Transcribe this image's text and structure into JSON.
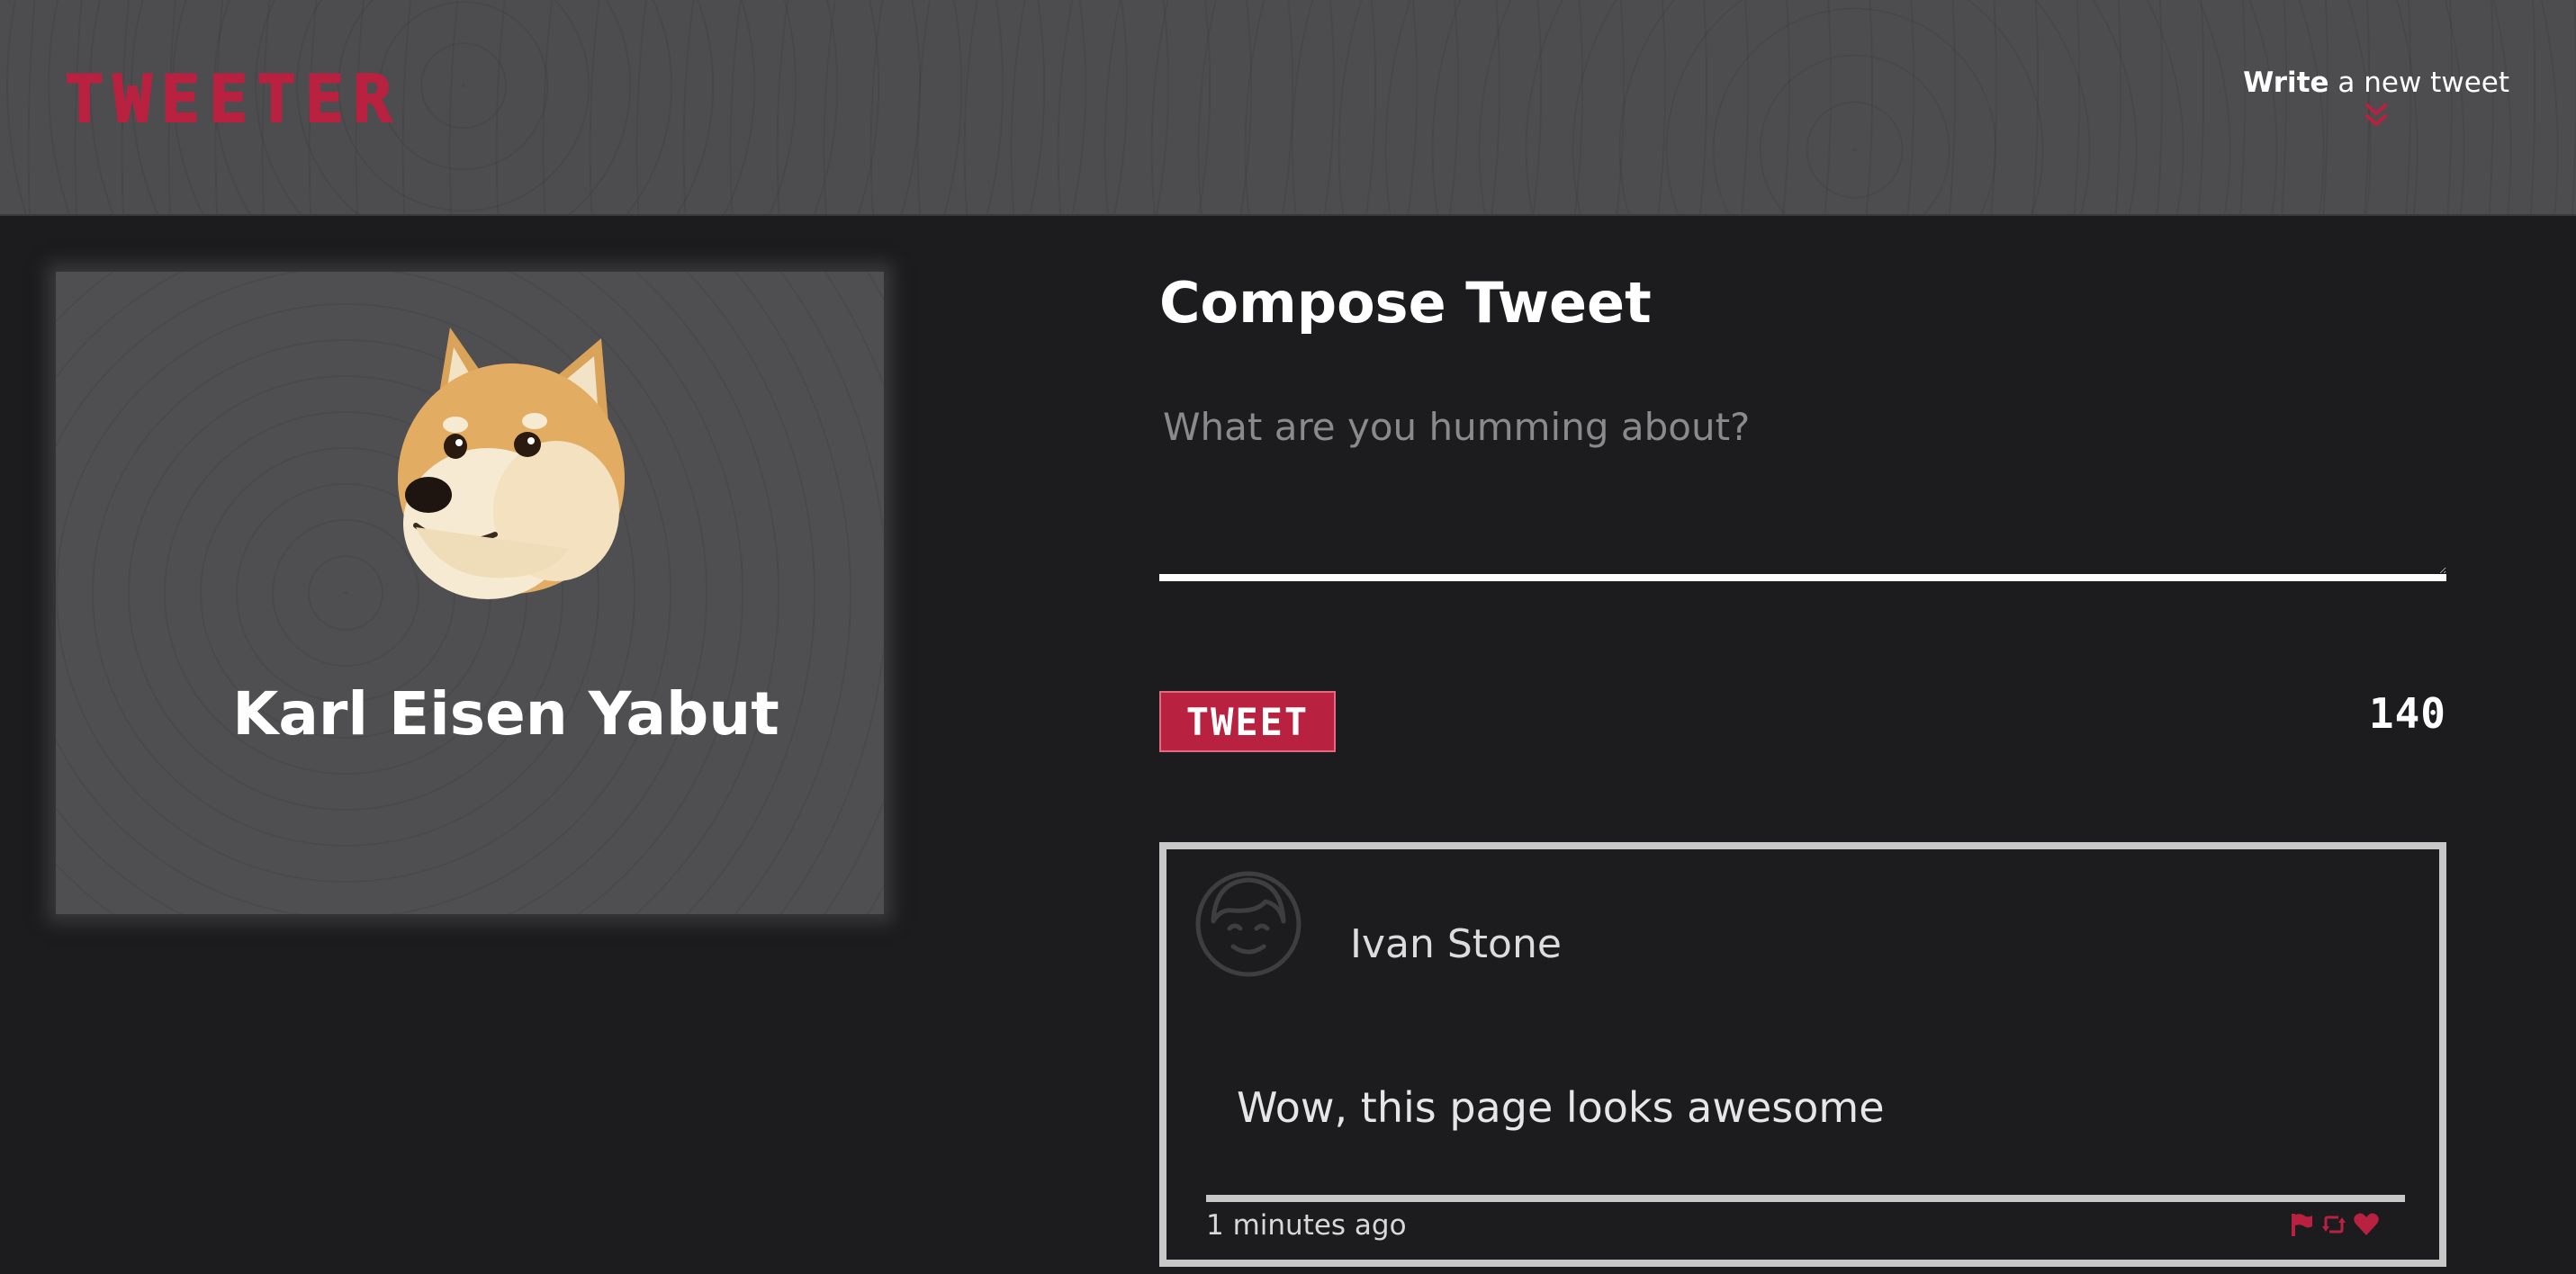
{
  "header": {
    "logo": "TWEETER",
    "compose_link": {
      "strong": "Write",
      "rest": "a new tweet",
      "icon": "double-chevron-down-icon"
    }
  },
  "profile": {
    "avatar": "doge-avatar",
    "name": "Karl Eisen Yabut"
  },
  "compose": {
    "title": "Compose Tweet",
    "placeholder": "What are you humming about?",
    "value": "",
    "button_label": "TWEET",
    "char_count": "140"
  },
  "tweets": [
    {
      "avatar": "smiling-face-avatar-icon",
      "author": "Ivan Stone",
      "body": "Wow, this page looks awesome",
      "time": "1 minutes ago",
      "actions": [
        "flag-icon",
        "retweet-icon",
        "heart-icon"
      ]
    }
  ],
  "colors": {
    "accent": "#b8213f",
    "header_bg": "#4d4d4f",
    "page_bg": "#1c1c1e",
    "text": "#ffffff",
    "card_border": "#c8c8c8"
  }
}
